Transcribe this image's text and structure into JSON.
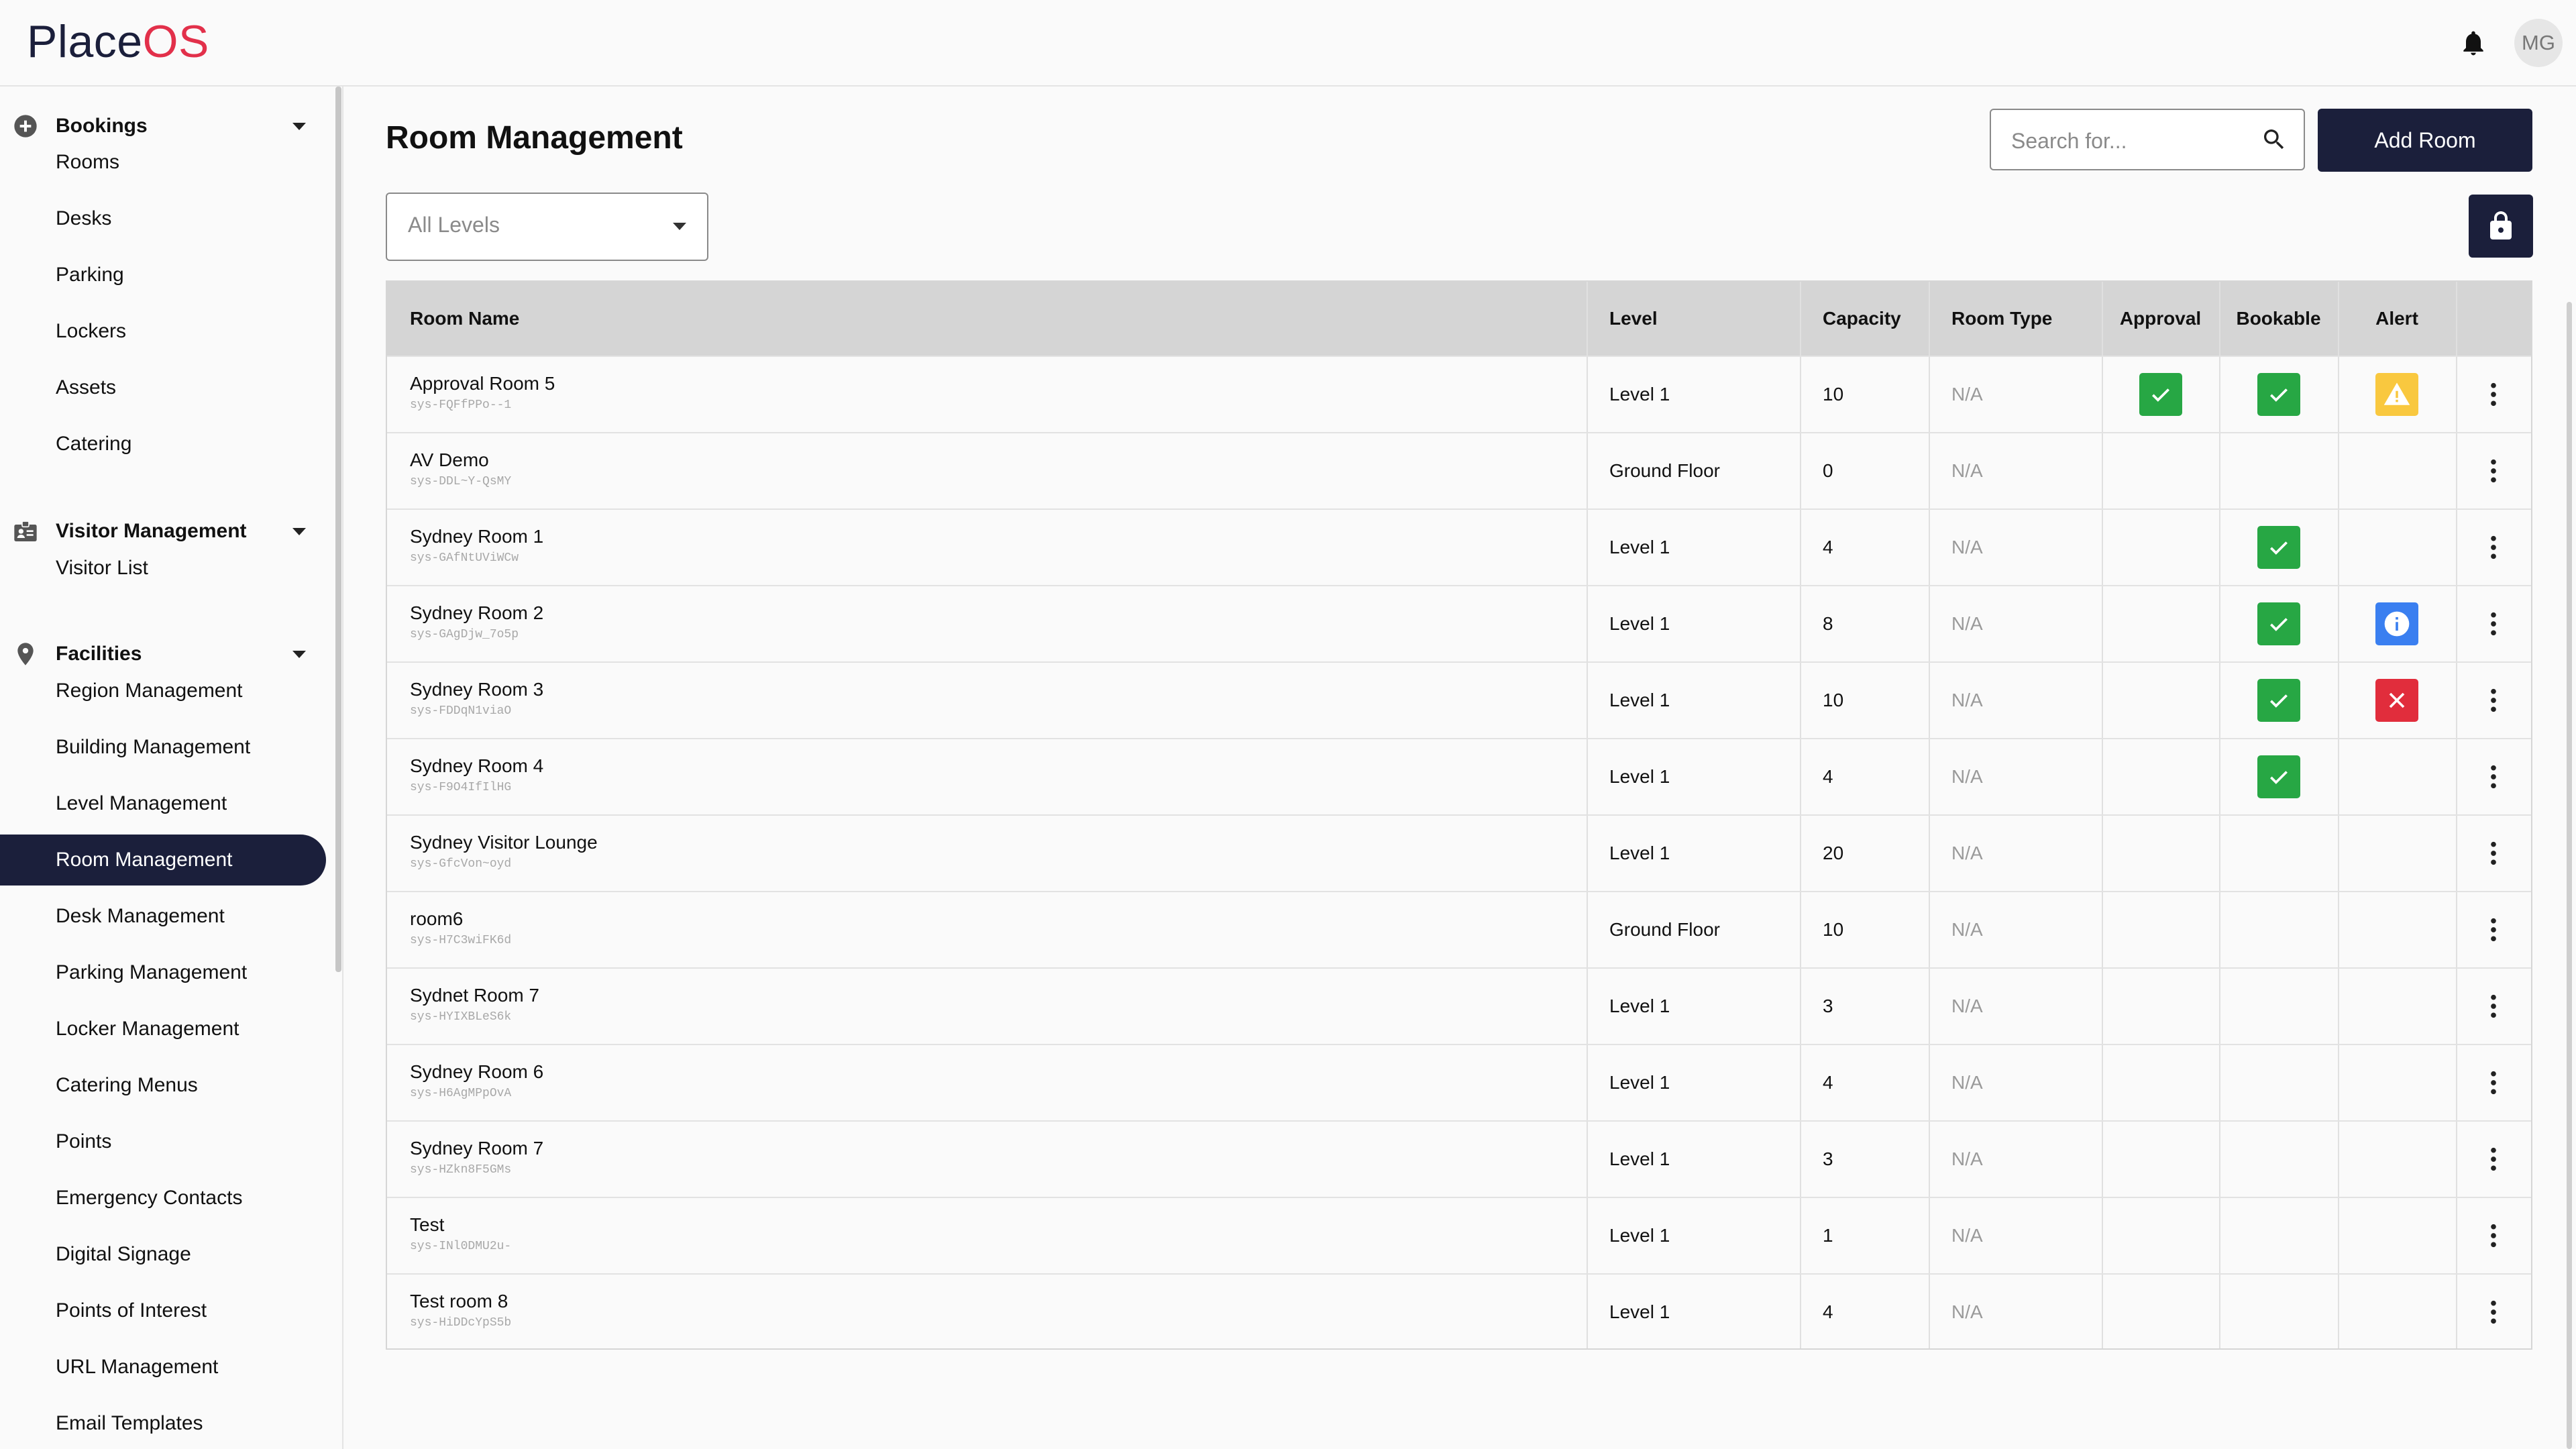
{
  "app": {
    "logo_place": "Place",
    "logo_os": "OS",
    "user_initials": "MG",
    "brand_color": "#1b1f3b",
    "logo_accent": "#e2304a"
  },
  "sidebar": {
    "sections": [
      {
        "label": "Bookings",
        "icon": "plus-circle-icon",
        "items": [
          "Rooms",
          "Desks",
          "Parking",
          "Lockers",
          "Assets",
          "Catering"
        ]
      },
      {
        "label": "Visitor Management",
        "icon": "id-badge-icon",
        "items": [
          "Visitor List"
        ]
      },
      {
        "label": "Facilities",
        "icon": "map-pin-icon",
        "items": [
          "Region Management",
          "Building Management",
          "Level Management",
          "Room Management",
          "Desk Management",
          "Parking Management",
          "Locker Management",
          "Catering Menus",
          "Points",
          "Emergency Contacts",
          "Digital Signage",
          "Points of Interest",
          "URL Management",
          "Email Templates"
        ]
      }
    ],
    "active_item": "Room Management"
  },
  "main": {
    "title": "Room Management",
    "search_placeholder": "Search for...",
    "add_button": "Add Room",
    "level_filter": "All Levels"
  },
  "table": {
    "columns": [
      "Room Name",
      "Level",
      "Capacity",
      "Room Type",
      "Approval",
      "Bookable",
      "Alert",
      ""
    ],
    "rows": [
      {
        "name": "Approval Room 5",
        "id": "sys-FQFfPPo--1",
        "level": "Level 1",
        "capacity": "10",
        "room_type": "N/A",
        "approval": true,
        "bookable": true,
        "alert": "warning"
      },
      {
        "name": "AV Demo",
        "id": "sys-DDL~Y-QsMY",
        "level": "Ground Floor",
        "capacity": "0",
        "room_type": "N/A",
        "approval": false,
        "bookable": false,
        "alert": ""
      },
      {
        "name": "Sydney Room 1",
        "id": "sys-GAfNtUViWCw",
        "level": "Level 1",
        "capacity": "4",
        "room_type": "N/A",
        "approval": false,
        "bookable": true,
        "alert": ""
      },
      {
        "name": "Sydney Room 2",
        "id": "sys-GAgDjw_7o5p",
        "level": "Level 1",
        "capacity": "8",
        "room_type": "N/A",
        "approval": false,
        "bookable": true,
        "alert": "info"
      },
      {
        "name": "Sydney Room 3",
        "id": "sys-FDDqN1viaO",
        "level": "Level 1",
        "capacity": "10",
        "room_type": "N/A",
        "approval": false,
        "bookable": true,
        "alert": "error"
      },
      {
        "name": "Sydney Room 4",
        "id": "sys-F9O4IfIlHG",
        "level": "Level 1",
        "capacity": "4",
        "room_type": "N/A",
        "approval": false,
        "bookable": true,
        "alert": ""
      },
      {
        "name": "Sydney Visitor Lounge",
        "id": "sys-GfcVon~oyd",
        "level": "Level 1",
        "capacity": "20",
        "room_type": "N/A",
        "approval": false,
        "bookable": false,
        "alert": ""
      },
      {
        "name": "room6",
        "id": "sys-H7C3wiFK6d",
        "level": "Ground Floor",
        "capacity": "10",
        "room_type": "N/A",
        "approval": false,
        "bookable": false,
        "alert": ""
      },
      {
        "name": "Sydnet Room 7",
        "id": "sys-HYIXBLeS6k",
        "level": "Level 1",
        "capacity": "3",
        "room_type": "N/A",
        "approval": false,
        "bookable": false,
        "alert": ""
      },
      {
        "name": "Sydney Room 6",
        "id": "sys-H6AgMPpOvA",
        "level": "Level 1",
        "capacity": "4",
        "room_type": "N/A",
        "approval": false,
        "bookable": false,
        "alert": ""
      },
      {
        "name": "Sydney Room 7",
        "id": "sys-HZkn8F5GMs",
        "level": "Level 1",
        "capacity": "3",
        "room_type": "N/A",
        "approval": false,
        "bookable": false,
        "alert": ""
      },
      {
        "name": "Test",
        "id": "sys-INl0DMU2u-",
        "level": "Level 1",
        "capacity": "1",
        "room_type": "N/A",
        "approval": false,
        "bookable": false,
        "alert": ""
      },
      {
        "name": "Test room 8",
        "id": "sys-HiDDcYpS5b",
        "level": "Level 1",
        "capacity": "4",
        "room_type": "N/A",
        "approval": false,
        "bookable": false,
        "alert": ""
      }
    ]
  },
  "colors": {
    "check_green": "#27a744",
    "warning_yellow": "#f9c83f",
    "info_blue": "#3a7ff0",
    "error_red": "#e12d3c"
  }
}
